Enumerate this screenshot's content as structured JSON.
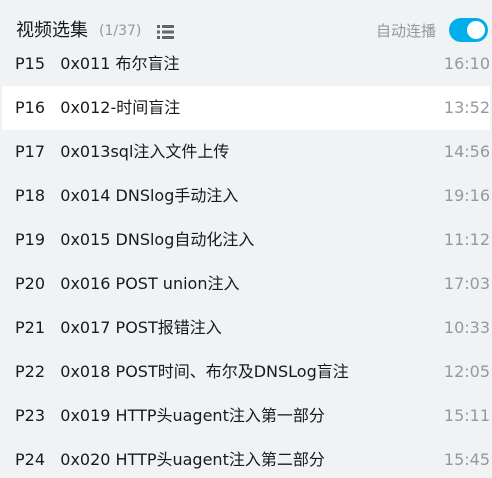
{
  "header": {
    "title": "视频选集",
    "count": "(1/37)",
    "autoplay_label": "自动连播",
    "autoplay_on": true
  },
  "episodes": [
    {
      "label": "P15   0x011 布尔盲注",
      "duration": "16:10",
      "active": false
    },
    {
      "label": "P16   0x012-时间盲注",
      "duration": "13:52",
      "active": true
    },
    {
      "label": "P17   0x013sql注入文件上传",
      "duration": "14:56",
      "active": false
    },
    {
      "label": "P18   0x014 DNSlog手动注入",
      "duration": "19:16",
      "active": false
    },
    {
      "label": "P19   0x015 DNSlog自动化注入",
      "duration": "11:12",
      "active": false
    },
    {
      "label": "P20   0x016 POST union注入",
      "duration": "17:03",
      "active": false
    },
    {
      "label": "P21   0x017 POST报错注入",
      "duration": "10:33",
      "active": false
    },
    {
      "label": "P22   0x018 POST时间、布尔及DNSLog盲注",
      "duration": "12:05",
      "active": false
    },
    {
      "label": "P23   0x019 HTTP头uagent注入第一部分",
      "duration": "15:11",
      "active": false
    },
    {
      "label": "P24   0x020 HTTP头uagent注入第二部分",
      "duration": "15:45",
      "active": false
    }
  ],
  "colors": {
    "accent": "#00aeec",
    "text": "#18191c",
    "muted": "#9499a0",
    "background": "#f1f2f3",
    "active_row": "#ffffff"
  },
  "icons": {
    "list_view": "list-view-icon"
  }
}
